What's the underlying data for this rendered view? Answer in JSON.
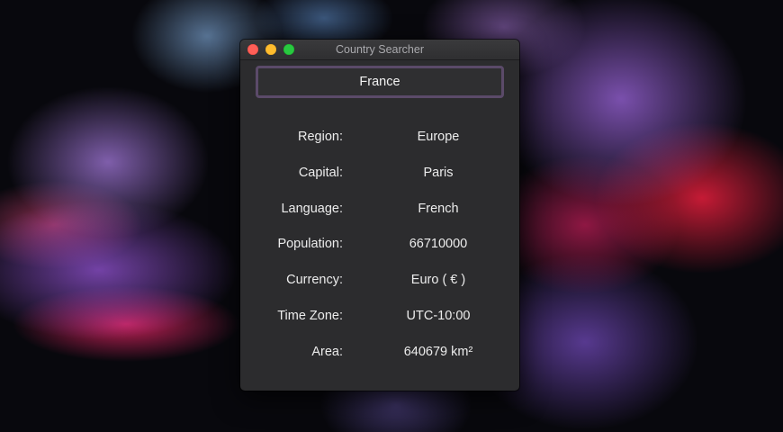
{
  "window": {
    "title": "Country Searcher"
  },
  "search": {
    "value": "France"
  },
  "fields": [
    {
      "label": "Region:",
      "value": "Europe"
    },
    {
      "label": "Capital:",
      "value": "Paris"
    },
    {
      "label": "Language:",
      "value": "French"
    },
    {
      "label": "Population:",
      "value": "66710000"
    },
    {
      "label": "Currency:",
      "value": "Euro ( € )"
    },
    {
      "label": "Time Zone:",
      "value": "UTC-10:00"
    },
    {
      "label": "Area:",
      "value": "640679 km²"
    }
  ],
  "colors": {
    "window_bg": "#2c2c2e",
    "search_border": "#5b4a69",
    "close": "#ff5f57",
    "minimize": "#febc2e",
    "zoom": "#28c840"
  }
}
